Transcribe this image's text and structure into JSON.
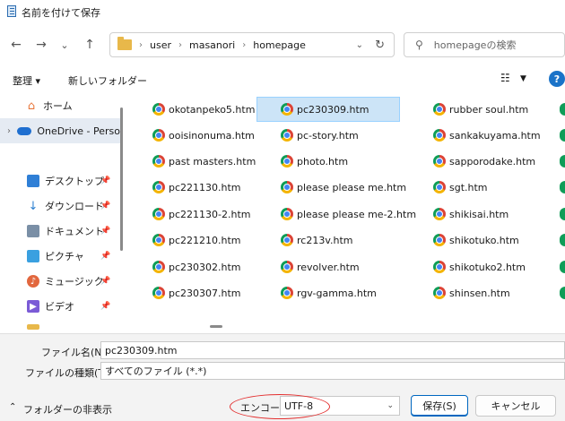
{
  "window": {
    "title": "名前を付けて保存"
  },
  "nav": {
    "back_icon": "←",
    "forward_icon": "→",
    "dropdown_icon": "⌄",
    "up_icon": "↑",
    "breadcrumb": [
      "user",
      "masanori",
      "homepage"
    ],
    "search_placeholder": "homepageの検索"
  },
  "toolbar": {
    "organize": "整理 ▾",
    "new_folder": "新しいフォルダー",
    "view_icon": "☷",
    "help": "?"
  },
  "sidebar": {
    "home": "ホーム",
    "onedrive": "OneDrive - Perso",
    "items": [
      {
        "label": "デスクトップ",
        "icon": "desktop-icon",
        "color": "#2f7fd6"
      },
      {
        "label": "ダウンロード",
        "icon": "download-icon",
        "color": "#2b7fd0"
      },
      {
        "label": "ドキュメント",
        "icon": "document-icon",
        "color": "#7a8fa6"
      },
      {
        "label": "ピクチャ",
        "icon": "pictures-icon",
        "color": "#3aa0e0"
      },
      {
        "label": "ミュージック",
        "icon": "music-icon",
        "color": "#e2673e"
      },
      {
        "label": "ビデオ",
        "icon": "video-icon",
        "color": "#7b5bd6"
      }
    ]
  },
  "files": {
    "col1": [
      "okotanpeko5.htm",
      "ooisinonuma.htm",
      "past masters.htm",
      "pc221130.htm",
      "pc221130-2.htm",
      "pc221210.htm",
      "pc230302.htm",
      "pc230307.htm"
    ],
    "col2": [
      "pc230309.htm",
      "pc-story.htm",
      "photo.htm",
      "please please me.htm",
      "please please me-2.htm",
      "rc213v.htm",
      "revolver.htm",
      "rgv-gamma.htm"
    ],
    "col3": [
      "rubber soul.htm",
      "sankakuyama.htm",
      "sapporodake.htm",
      "sgt.htm",
      "shikisai.htm",
      "shikotuko.htm",
      "shikotuko2.htm",
      "shinsen.htm"
    ],
    "selected": "pc230309.htm"
  },
  "form": {
    "filename_label": "ファイル名(N):",
    "filename_value": "pc230309.htm",
    "filetype_label": "ファイルの種類(T):",
    "filetype_value": "すべてのファイル (*.*)",
    "hide_folders": "フォルダーの非表示",
    "encode_label": "エンコード:",
    "encode_value": "UTF-8",
    "save_button": "保存(S)",
    "cancel_button": "キャンセル"
  },
  "colors": {
    "selection": "#cce4f7",
    "accent": "#0067c0",
    "highlight_ellipse": "#e32f2f"
  }
}
